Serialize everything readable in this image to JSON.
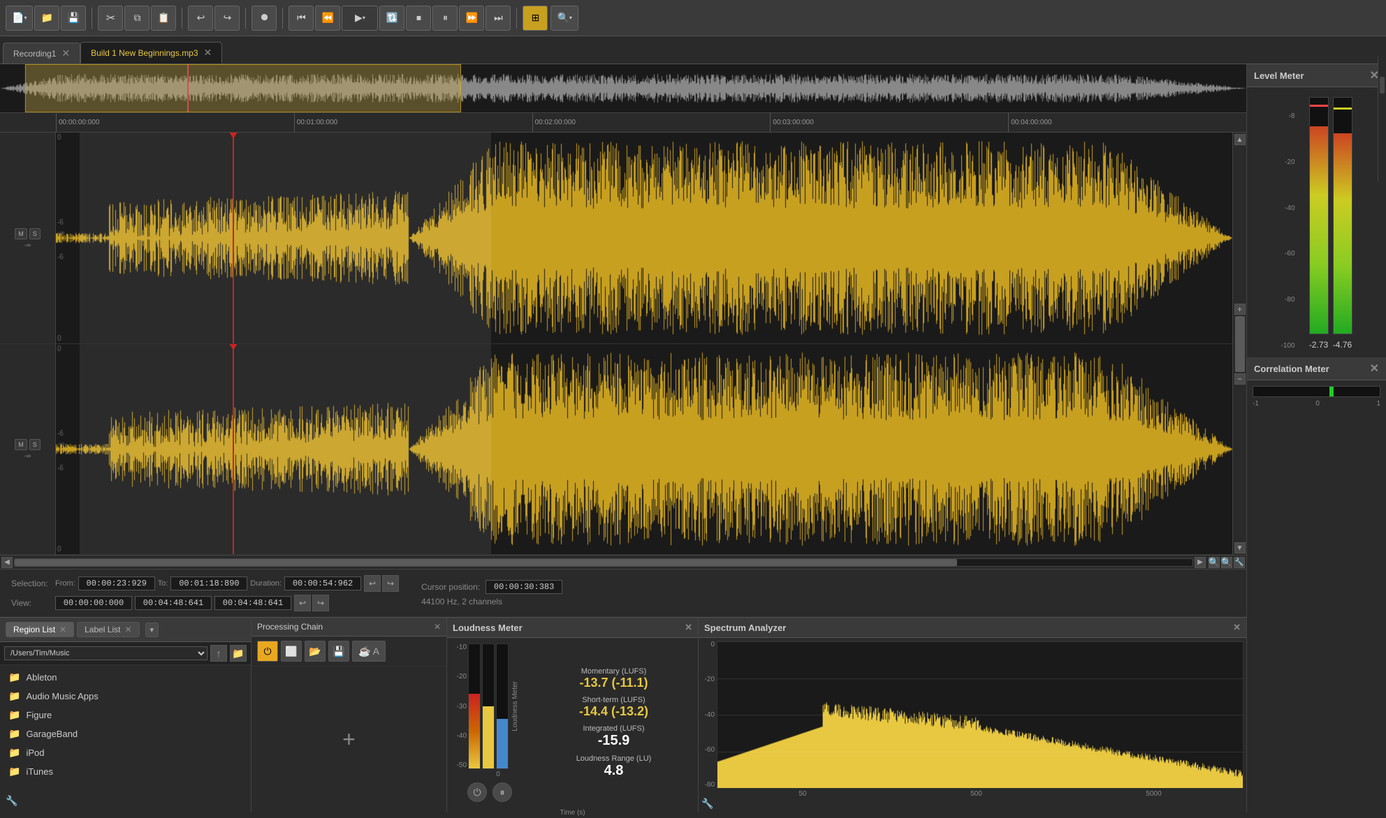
{
  "toolbar": {
    "buttons": [
      {
        "id": "new",
        "label": "📄▾",
        "name": "new-button"
      },
      {
        "id": "open",
        "label": "📁",
        "name": "open-button"
      },
      {
        "id": "save",
        "label": "💾",
        "name": "save-button"
      },
      {
        "id": "cut",
        "label": "✂",
        "name": "cut-button"
      },
      {
        "id": "copy",
        "label": "⿻",
        "name": "copy-button"
      },
      {
        "id": "paste",
        "label": "📋",
        "name": "paste-button"
      },
      {
        "id": "undo",
        "label": "↩",
        "name": "undo-button"
      },
      {
        "id": "redo",
        "label": "↪",
        "name": "redo-button"
      },
      {
        "id": "record",
        "label": "⏺",
        "name": "record-button"
      },
      {
        "id": "skip-start",
        "label": "⏮",
        "name": "skip-start-button"
      },
      {
        "id": "rewind",
        "label": "⏪",
        "name": "rewind-button"
      },
      {
        "id": "play",
        "label": "▶▾",
        "name": "play-button"
      },
      {
        "id": "loop",
        "label": "🔃",
        "name": "loop-button"
      },
      {
        "id": "stop",
        "label": "⏹",
        "name": "stop-button"
      },
      {
        "id": "pause",
        "label": "⏸",
        "name": "pause-button"
      },
      {
        "id": "fast-forward",
        "label": "⏩",
        "name": "fast-forward-button"
      },
      {
        "id": "skip-end",
        "label": "⏭",
        "name": "skip-end-button"
      },
      {
        "id": "snap",
        "label": "⊞",
        "name": "snap-button"
      },
      {
        "id": "zoom-tool",
        "label": "🔍▾",
        "name": "zoom-tool-button"
      }
    ]
  },
  "tabs": [
    {
      "id": "recording1",
      "label": "Recording1",
      "active": false
    },
    {
      "id": "build1",
      "label": "Build 1 New Beginnings.mp3",
      "active": true
    }
  ],
  "timeline": {
    "markers": [
      "00:00:00:000",
      "00:01:00:000",
      "00:02:00:000",
      "00:03:00:000",
      "00:04:00:000"
    ]
  },
  "selection": {
    "label": "Selection:",
    "from_label": "From:",
    "to_label": "To:",
    "duration_label": "Duration:",
    "from": "00:00:23:929",
    "to": "00:01:18:890",
    "duration": "00:00:54:962",
    "cursor_label": "Cursor position:",
    "cursor_pos": "00:00:30:383",
    "sample_info": "44100 Hz, 2 channels"
  },
  "view": {
    "label": "View:",
    "from": "00:00:00:000",
    "to": "00:04:48:641",
    "duration": "00:04:48:641"
  },
  "level_meter": {
    "title": "Level Meter",
    "left_value": "-2.73",
    "right_value": "-4.76",
    "scale": [
      "-8",
      "-20",
      "-40",
      "-60",
      "-80",
      "-100"
    ]
  },
  "correlation_meter": {
    "title": "Correlation Meter",
    "labels": [
      "-1",
      "0",
      "1"
    ]
  },
  "region_list": {
    "title": "Region List",
    "label_list": "Label List",
    "path": "/Users/Tim/Music",
    "files": [
      {
        "name": "Ableton",
        "type": "folder"
      },
      {
        "name": "Audio Music Apps",
        "type": "folder"
      },
      {
        "name": "Figure",
        "type": "folder"
      },
      {
        "name": "GarageBand",
        "type": "folder"
      },
      {
        "name": "iPod",
        "type": "folder"
      },
      {
        "name": "iTunes",
        "type": "folder"
      }
    ]
  },
  "processing_chain": {
    "title": "Processing Chain",
    "buttons": [
      {
        "id": "power",
        "label": "⏻",
        "name": "power-button"
      },
      {
        "id": "new",
        "label": "⬜",
        "name": "new-proc-button"
      },
      {
        "id": "open",
        "label": "📂",
        "name": "open-proc-button"
      },
      {
        "id": "save",
        "label": "💾",
        "name": "save-proc-button"
      },
      {
        "id": "extra",
        "label": "☕ A",
        "name": "extra-button"
      }
    ],
    "add_label": "+"
  },
  "loudness_meter": {
    "title": "Loudness Meter",
    "momentary_label": "Momentary (LUFS)",
    "momentary_value": "-13.7 (-11.1)",
    "short_term_label": "Short-term (LUFS)",
    "short_term_value": "-14.4 (-13.2)",
    "integrated_label": "Integrated (LUFS)",
    "integrated_value": "-15.9",
    "range_label": "Loudness Range (LU)",
    "range_value": "4.8",
    "time_label": "Time (s)",
    "scale": [
      "-10",
      "-20",
      "-30",
      "-40",
      "-50"
    ],
    "x_labels": [
      "0"
    ]
  },
  "spectrum_analyzer": {
    "title": "Spectrum Analyzer",
    "y_labels": [
      "0",
      "-20",
      "-40",
      "-60",
      "-80"
    ],
    "x_labels": [
      "50",
      "500",
      "5000"
    ]
  },
  "colors": {
    "accent": "#e8c840",
    "active_tab": "#e8c840",
    "waveform": "#c8a020",
    "waveform_dark": "#6a4a00",
    "playhead": "#cc2222",
    "green": "#22cc22",
    "blue": "#4488cc"
  }
}
